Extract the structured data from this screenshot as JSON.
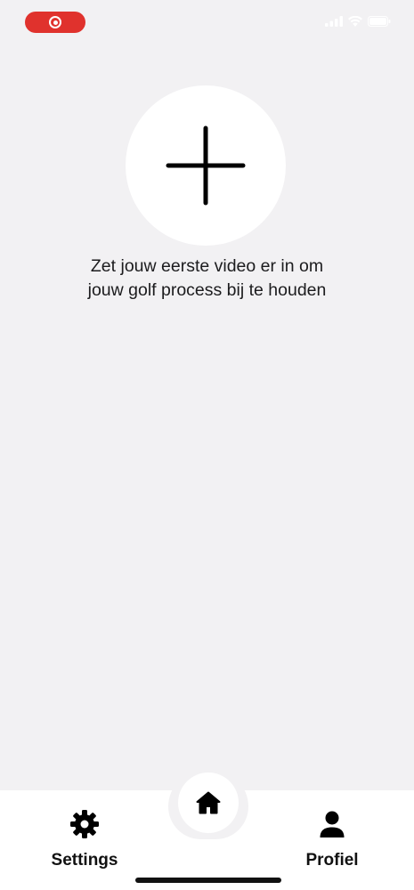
{
  "status_bar": {
    "recording_icon": "screen-recording-icon",
    "signal_icon": "cellular-signal-icon",
    "wifi_icon": "wifi-icon",
    "battery_icon": "battery-icon"
  },
  "main": {
    "add_video_icon": "plus-icon",
    "empty_message": "Zet jouw eerste video er in om jouw golf process bij te houden"
  },
  "bottom_nav": {
    "settings_label": "Settings",
    "settings_icon": "gear-icon",
    "home_icon": "home-icon",
    "profile_label": "Profiel",
    "profile_icon": "person-icon"
  },
  "colors": {
    "background": "#f2f1f3",
    "recording_pill": "#e0322d",
    "nav_background": "#ffffff",
    "text": "#1c1c1e"
  }
}
